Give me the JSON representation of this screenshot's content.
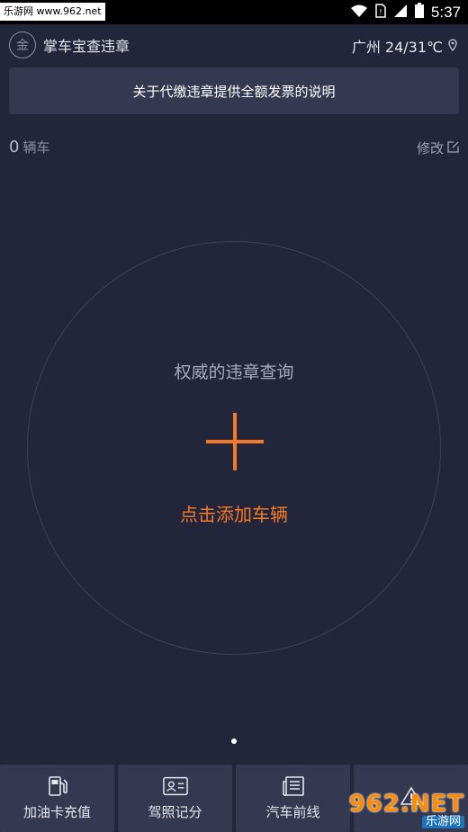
{
  "status_bar": {
    "watermark": "乐游网 www.962.net",
    "time": "5:37"
  },
  "header": {
    "app_title": "掌车宝查违章",
    "logo_glyph": "金",
    "weather": "广州 24/31℃"
  },
  "notice": {
    "text": "关于代缴违章提供全额发票的说明"
  },
  "vehicles": {
    "count": "0",
    "count_label": "辆车",
    "edit_label": "修改"
  },
  "circle": {
    "subtitle": "权威的违章查询",
    "action": "点击添加车辆"
  },
  "bottom_nav": {
    "items": [
      {
        "label": "加油卡充值",
        "icon": "gas-pump-icon"
      },
      {
        "label": "驾照记分",
        "icon": "license-card-icon"
      },
      {
        "label": "汽车前线",
        "icon": "newspaper-icon"
      },
      {
        "label": "",
        "icon": "warning-icon"
      }
    ]
  },
  "watermark_bottom": {
    "brand": "962.NET",
    "sub": "乐游网"
  },
  "colors": {
    "background": "#23263a",
    "card": "#343850",
    "accent": "#f37a26"
  }
}
